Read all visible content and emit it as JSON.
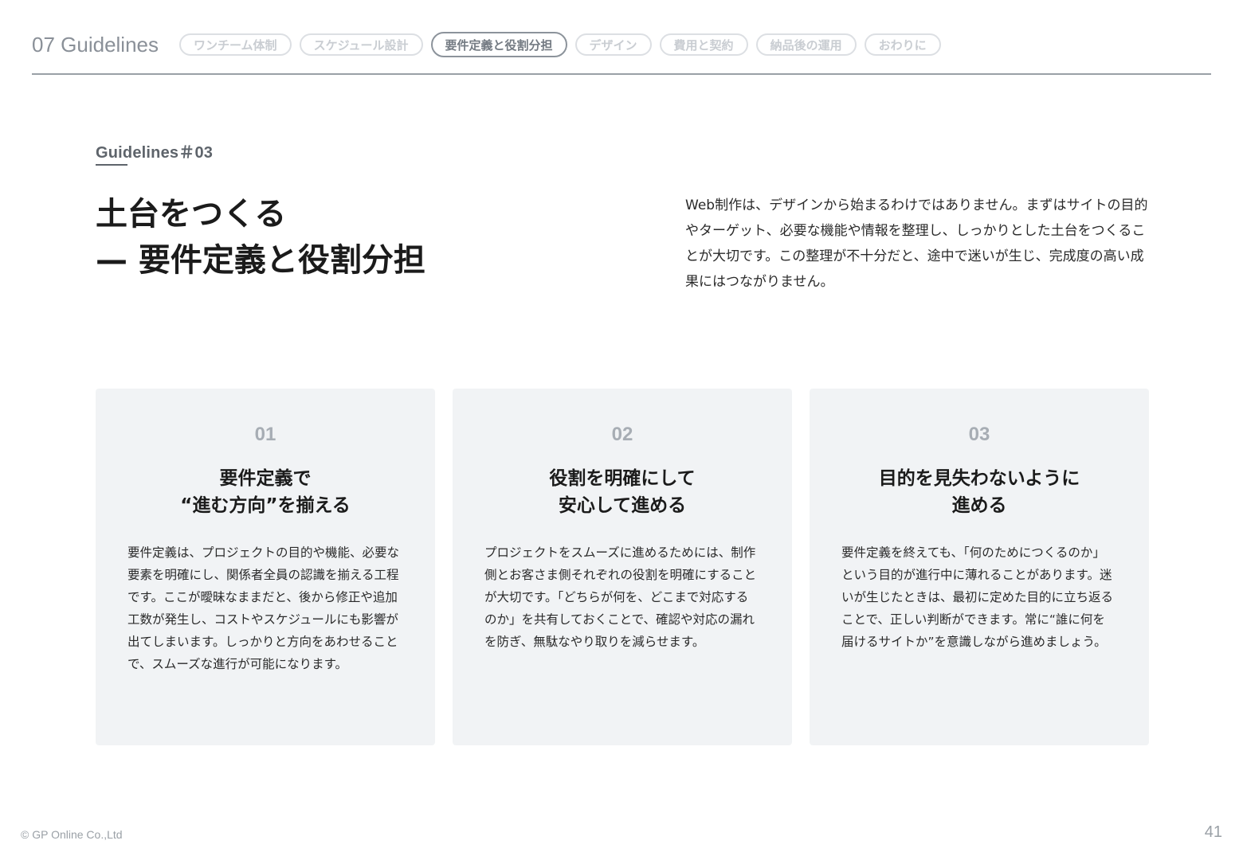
{
  "header": {
    "section_title": "07 Guidelines",
    "tabs": [
      {
        "label": "ワンチーム体制",
        "active": false
      },
      {
        "label": "スケジュール設計",
        "active": false
      },
      {
        "label": "要件定義と役割分担",
        "active": true
      },
      {
        "label": "デザイン",
        "active": false
      },
      {
        "label": "費用と契約",
        "active": false
      },
      {
        "label": "納品後の運用",
        "active": false
      },
      {
        "label": "おわりに",
        "active": false
      }
    ]
  },
  "main": {
    "eyebrow": "Guidelines＃03",
    "title_line1": "土台をつくる",
    "title_line2": "— 要件定義と役割分担",
    "intro": "Web制作は、デザインから始まるわけではありません。まずはサイトの目的やターゲット、必要な機能や情報を整理し、しっかりとした土台をつくることが大切です。この整理が不十分だと、途中で迷いが生じ、完成度の高い成果にはつながりません。"
  },
  "cards": [
    {
      "number": "01",
      "title_line1": "要件定義で",
      "title_line2": "“進む方向”を揃える",
      "body": "要件定義は、プロジェクトの目的や機能、必要な要素を明確にし、関係者全員の認識を揃える工程です。ここが曖昧なままだと、後から修正や追加工数が発生し、コストやスケジュールにも影響が出てしまいます。しっかりと方向をあわせることで、スムーズな進行が可能になります。"
    },
    {
      "number": "02",
      "title_line1": "役割を明確にして",
      "title_line2": "安心して進める",
      "body": "プロジェクトをスムーズに進めるためには、制作側とお客さま側それぞれの役割を明確にすることが大切です。「どちらが何を、どこまで対応するのか」を共有しておくことで、確認や対応の漏れを防ぎ、無駄なやり取りを減らせます。"
    },
    {
      "number": "03",
      "title_line1": "目的を見失わないように",
      "title_line2": "進める",
      "body": "要件定義を終えても、「何のためにつくるのか」という目的が進行中に薄れることがあります。迷いが生じたときは、最初に定めた目的に立ち返ることで、正しい判断ができます。常に“誰に何を届けるサイトか”を意識しながら進めましょう。"
    }
  ],
  "footer": {
    "copyright": "© GP Online Co.,Ltd",
    "page_number": "41"
  },
  "colors": {
    "card_background": "#f1f3f5",
    "muted_text": "#9aa0a6",
    "active_tab_border": "#8c939b"
  }
}
